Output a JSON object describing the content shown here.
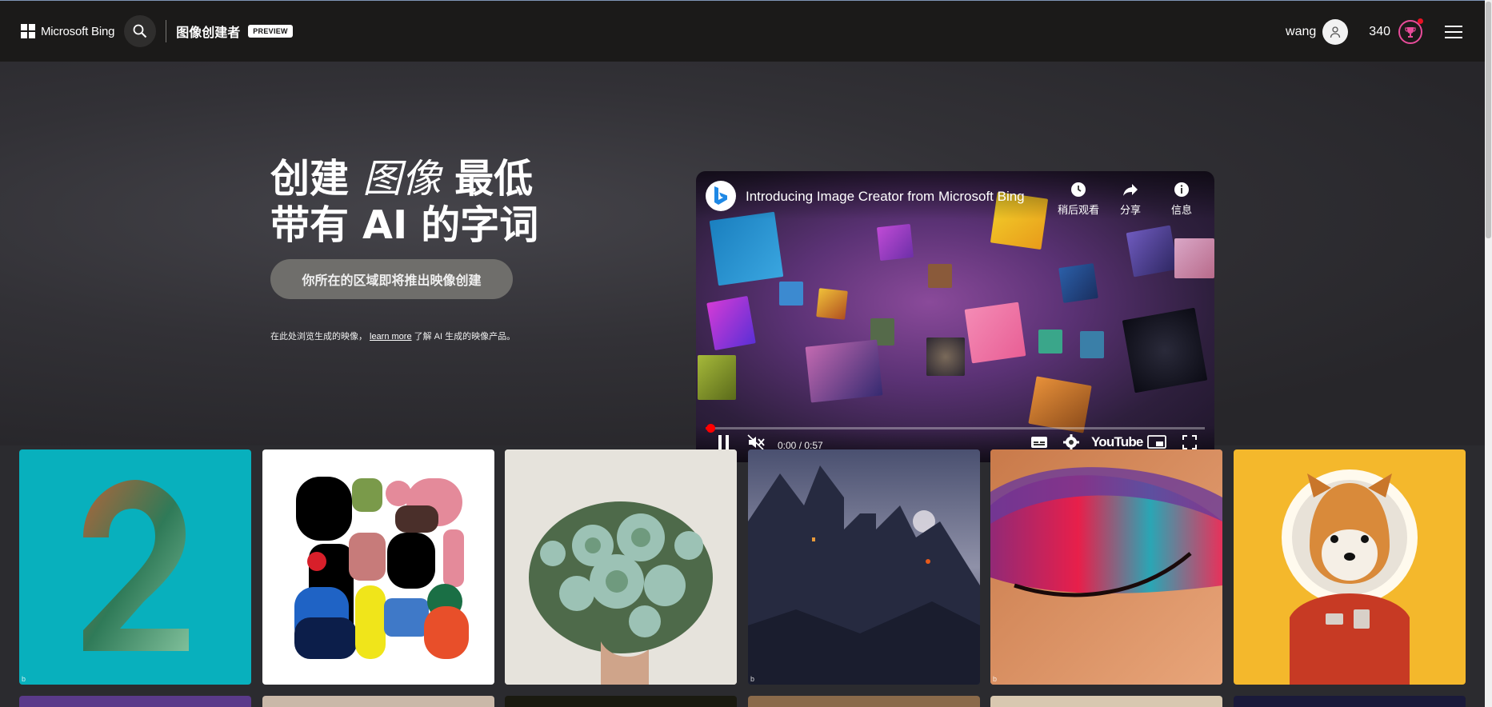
{
  "header": {
    "brand": "Microsoft Bing",
    "product_title": "图像创建者",
    "badge": "PREVIEW",
    "username": "wang",
    "points": "340"
  },
  "hero": {
    "title_part1": "创建",
    "title_emphasis": "图像",
    "title_part2": "最低",
    "title_line2": "带有 AI 的字词",
    "cta_label": "你所在的区域即将推出映像创建",
    "note_prefix": "在此处浏览生成的映像，",
    "note_link": "learn more",
    "note_suffix": "了解 AI 生成的映像产品。"
  },
  "video": {
    "title": "Introducing Image Creator from Microsoft Bing",
    "watch_later": "稍后观看",
    "share": "分享",
    "info": "信息",
    "time": "0:00 / 0:57",
    "brand": "YouTube",
    "progress": 0.01
  },
  "gallery": {
    "items": [
      {
        "subject": "number-2-chameleon",
        "bg": "#08b0bd"
      },
      {
        "subject": "abstract-shapes",
        "bg": "#ffffff"
      },
      {
        "subject": "succulent-bouquet",
        "bg": "#d9d5cc"
      },
      {
        "subject": "dark-castle",
        "bg": "#3b3f5a"
      },
      {
        "subject": "colorful-eye-makeup",
        "bg": "#d88a5a"
      },
      {
        "subject": "shiba-astronaut",
        "bg": "#f4b82c"
      }
    ]
  },
  "colors": {
    "topbar": "#1b1a19",
    "accent_reward": "#e84c9a",
    "progress": "#ff0000"
  }
}
